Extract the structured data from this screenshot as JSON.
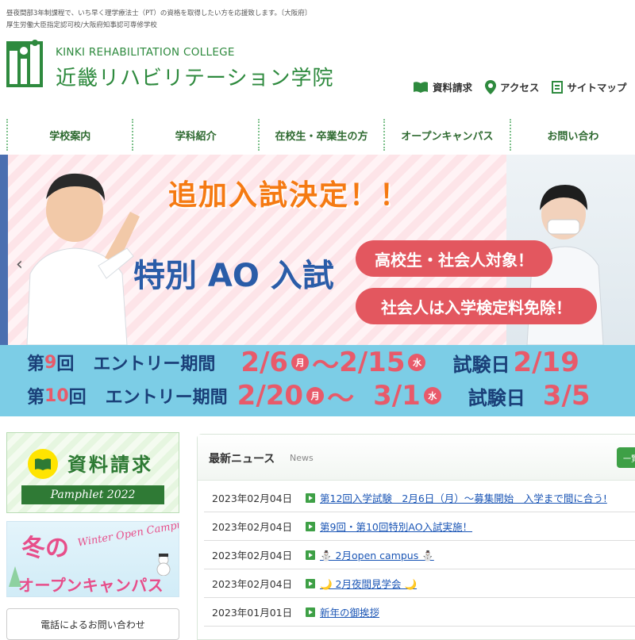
{
  "header": {
    "tagline": "昼夜間部3年制課程で、いち早く理学療法士（PT）の資格を取得したい方を応援致します。〔大阪府〕",
    "accreditation": "厚生労働大臣指定認可校/大阪府知事認可専修学校",
    "logo_en": "KINKI REHABILITATION COLLEGE",
    "logo_jp": "近畿リハビリテーション学院"
  },
  "utility_nav": [
    {
      "label": "資料請求",
      "icon": "book-icon"
    },
    {
      "label": "アクセス",
      "icon": "map-pin-icon"
    },
    {
      "label": "サイトマップ",
      "icon": "sitemap-icon"
    }
  ],
  "main_nav": [
    "学校案内",
    "学科紹介",
    "在校生・卒業生の方",
    "オープンキャンパス",
    "お問い合わ"
  ],
  "hero": {
    "headline": "追加入試決定！！",
    "exam_name": "特別 AO 入試",
    "pill1": "高校生・社会人対象！",
    "pill2": "社会人は入学検定料免除！",
    "row1": {
      "prefix": "第",
      "num": " 9",
      "suffix": " 回",
      "label": "エントリー期間",
      "d1": "2/6",
      "dow1": "月",
      "tilde": "～",
      "d2": "2/15",
      "dow2": "水",
      "exam": "試験日",
      "ed": "2/19"
    },
    "row2": {
      "prefix": "第",
      "num": "10",
      "suffix": " 回",
      "label": "エントリー期間",
      "d1": "2/20",
      "dow1": "月",
      "tilde": "～",
      "d2": "3/1",
      "dow2": "水",
      "exam": "試験日",
      "ed": "3/5"
    }
  },
  "sidebar": {
    "pamphlet_title": "資料請求",
    "pamphlet_ribbon": "Pamphlet 2022",
    "winter_title": "冬の",
    "winter_en": "Winter Open Campus!",
    "winter_sub": "オープンキャンパス",
    "phone_label": "電話によるお問い合わせ"
  },
  "news": {
    "title": "最新ニュース",
    "subtitle": "News",
    "button": "一覧",
    "items": [
      {
        "date": "2023年02月04日",
        "text": "第12回入学試験　2月6日（月）～募集開始　入学まで間に合う!"
      },
      {
        "date": "2023年02月04日",
        "text": "第9回・第10回特別AO入試実施！"
      },
      {
        "date": "2023年02月04日",
        "text": "⛄ 2月open campus ⛄"
      },
      {
        "date": "2023年02月04日",
        "text": "🌙 2月夜間見学会 🌙"
      },
      {
        "date": "2023年01月01日",
        "text": "新年の御挨拶"
      }
    ]
  },
  "colors": {
    "brand_green": "#2e8a3e",
    "accent_orange": "#f57a12",
    "accent_pink": "#e3575f",
    "schedule_blue": "#7ccde6",
    "link_blue": "#1a55b5"
  }
}
